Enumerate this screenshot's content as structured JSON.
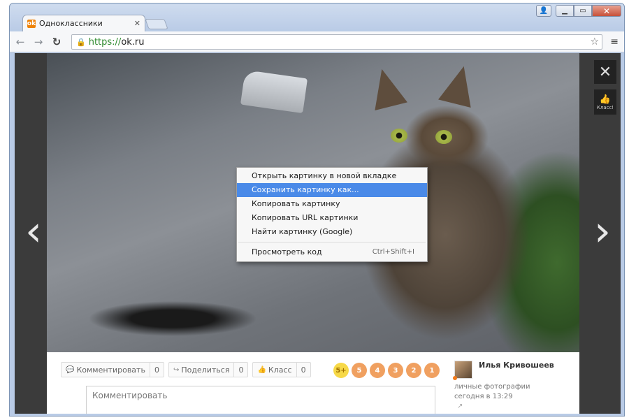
{
  "browser": {
    "tab_title": "Одноклассники",
    "tab_favicon": "ok-logo-icon",
    "url_protocol": "https://",
    "url_host": "ok.ru"
  },
  "viewer": {
    "close_label": "✕",
    "like_label": "Класс!"
  },
  "context_menu": {
    "items": [
      {
        "label": "Открыть картинку в новой вкладке",
        "shortcut": ""
      },
      {
        "label": "Сохранить картинку как...",
        "shortcut": "",
        "highlighted": true
      },
      {
        "label": "Копировать картинку",
        "shortcut": ""
      },
      {
        "label": "Копировать URL картинки",
        "shortcut": ""
      },
      {
        "label": "Найти картинку (Google)",
        "shortcut": ""
      }
    ],
    "inspect": {
      "label": "Просмотреть код",
      "shortcut": "Ctrl+Shift+I"
    }
  },
  "actions": {
    "comment": {
      "label": "Комментировать",
      "count": "0"
    },
    "share": {
      "label": "Поделиться",
      "count": "0"
    },
    "like": {
      "label": "Класс",
      "count": "0"
    }
  },
  "rating": [
    "5+",
    "5",
    "4",
    "3",
    "2",
    "1"
  ],
  "comment_placeholder": "Комментировать",
  "author": {
    "name": "Илья Кривошеев",
    "album": "личные фотографии",
    "date": "сегодня в 13:29"
  },
  "colors": {
    "accent": "#ee8208",
    "menu_highlight": "#4a8ae8",
    "rating": "#f0a060",
    "rating_top": "#f7d948"
  }
}
